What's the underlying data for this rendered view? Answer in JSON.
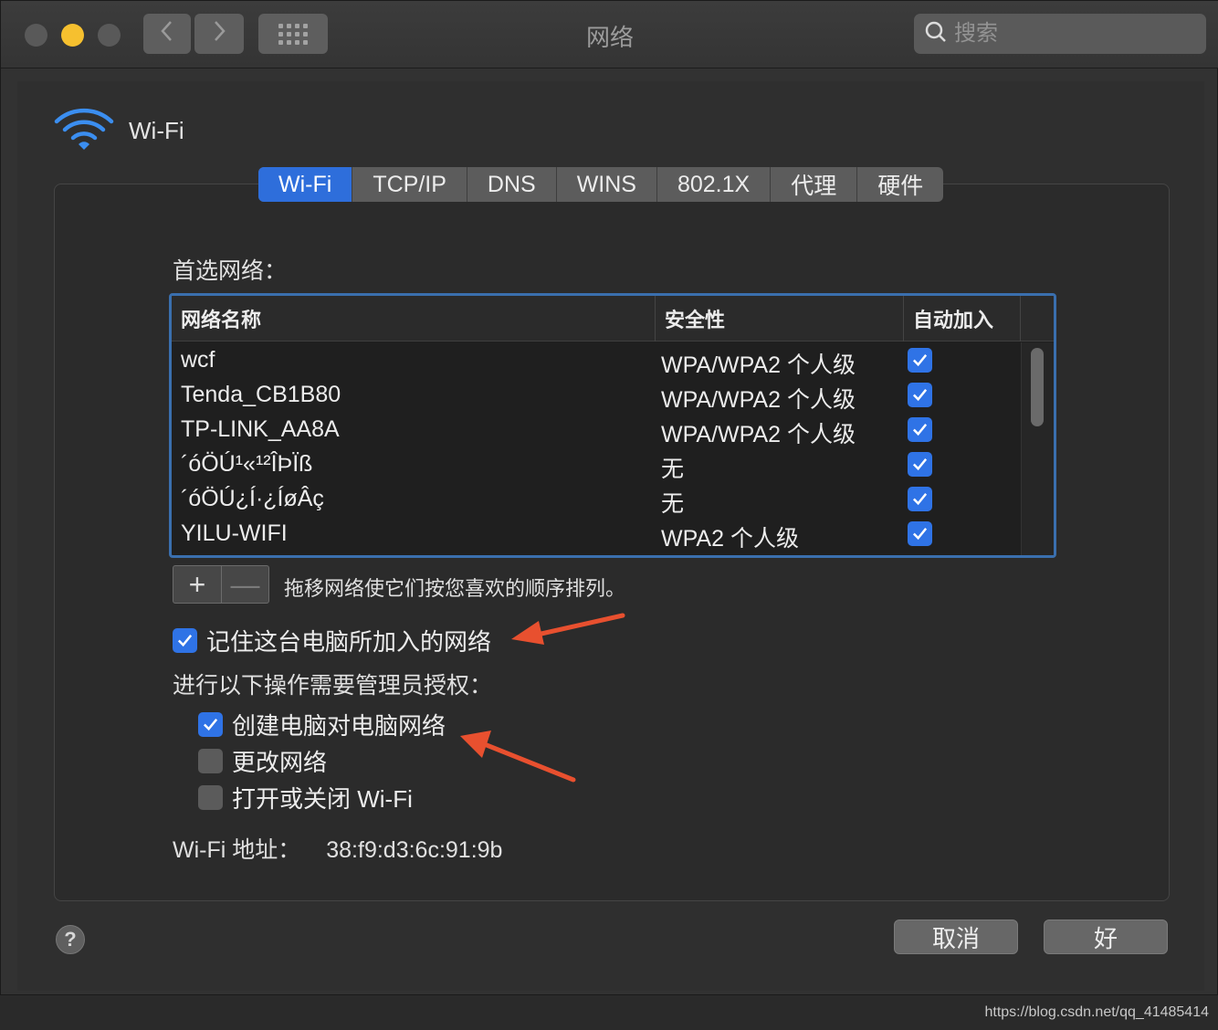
{
  "window": {
    "title": "网络"
  },
  "search": {
    "placeholder": "搜索"
  },
  "header": {
    "label": "Wi-Fi"
  },
  "tabs": [
    "Wi-Fi",
    "TCP/IP",
    "DNS",
    "WINS",
    "802.1X",
    "代理",
    "硬件"
  ],
  "preferred": {
    "label": "首选网络：",
    "columns": [
      "网络名称",
      "安全性",
      "自动加入"
    ],
    "rows": [
      {
        "name": "wcf",
        "security": "WPA/WPA2 个人级",
        "auto": true
      },
      {
        "name": "Tenda_CB1B80",
        "security": "WPA/WPA2 个人级",
        "auto": true
      },
      {
        "name": "TP-LINK_AA8A",
        "security": "WPA/WPA2 个人级",
        "auto": true
      },
      {
        "name": "´óÖÚ¹«¹²ÎÞÏß",
        "security": "无",
        "auto": true
      },
      {
        "name": "´óÖÚ¿Í·¿ÍøÂç",
        "security": "无",
        "auto": true
      },
      {
        "name": "YILU-WIFI",
        "security": "WPA2 个人级",
        "auto": true
      }
    ],
    "add_label": "+",
    "remove_label": "—",
    "hint": "拖移网络使它们按您喜欢的顺序排列。"
  },
  "remember": {
    "label": "记住这台电脑所加入的网络",
    "checked": true
  },
  "admin": {
    "label": "进行以下操作需要管理员授权：",
    "options": [
      {
        "label": "创建电脑对电脑网络",
        "checked": true
      },
      {
        "label": "更改网络",
        "checked": false
      },
      {
        "label": "打开或关闭 Wi-Fi",
        "checked": false
      }
    ]
  },
  "address": {
    "label": "Wi-Fi 地址：",
    "value": "38:f9:d3:6c:91:9b"
  },
  "buttons": {
    "help": "?",
    "cancel": "取消",
    "ok": "好"
  },
  "watermark": "https://blog.csdn.net/qq_41485414",
  "colors": {
    "accent": "#2f73e6",
    "arrow": "#e8502f"
  }
}
